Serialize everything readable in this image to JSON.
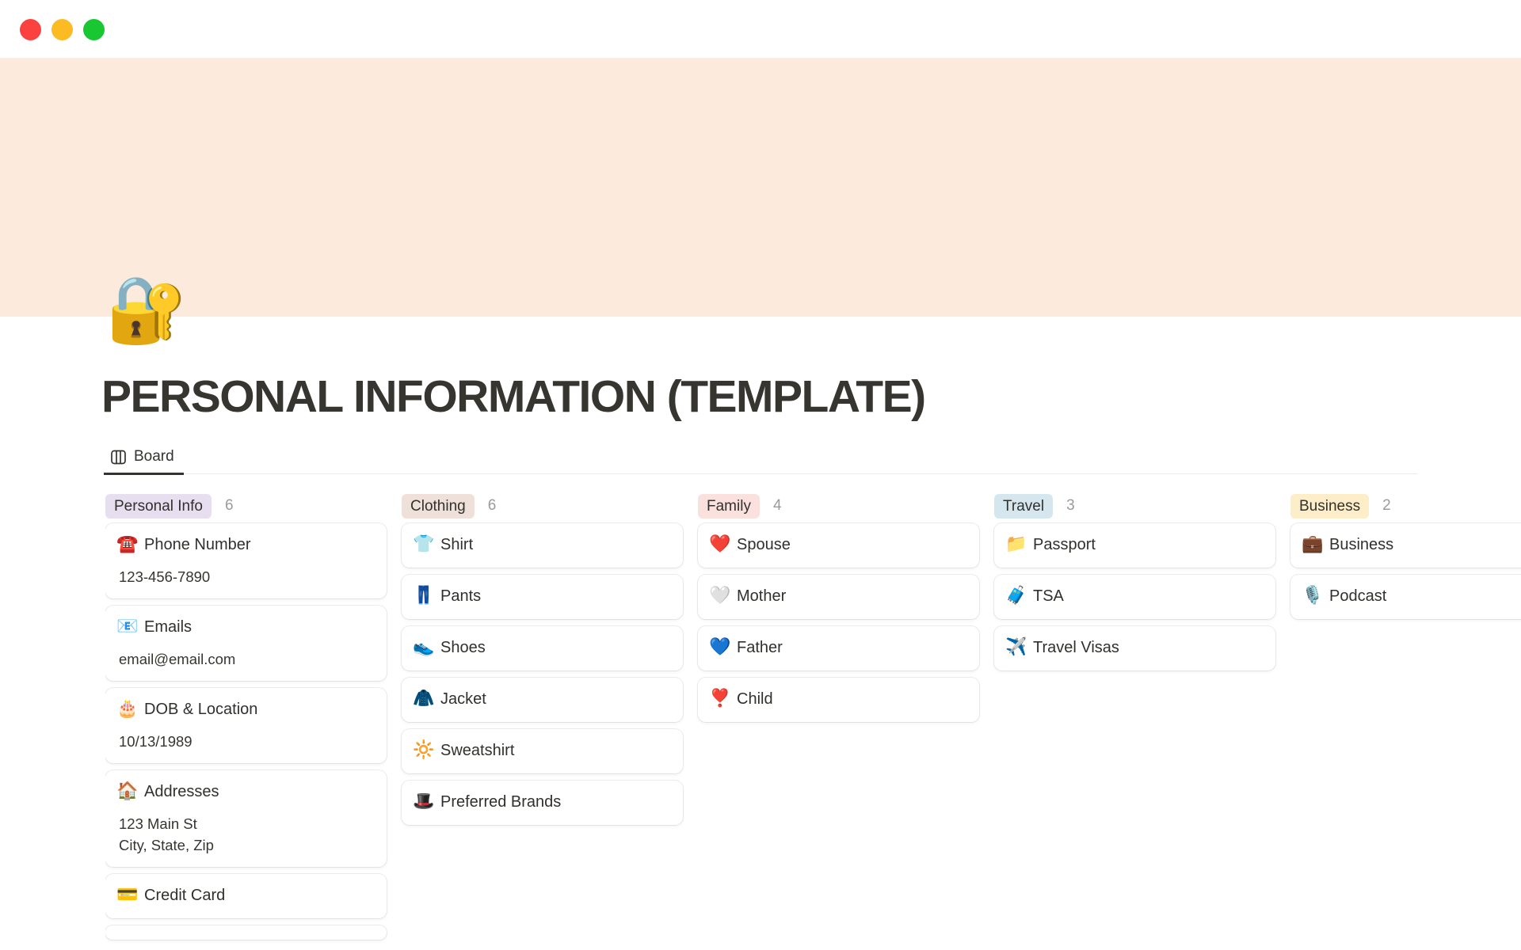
{
  "window": {
    "buttons": [
      {
        "name": "close",
        "color": "#fc4240"
      },
      {
        "name": "minimize",
        "color": "#fcba23"
      },
      {
        "name": "zoom",
        "color": "#19c732"
      }
    ]
  },
  "page": {
    "banner_color": "#fcebdd",
    "icon": "🔐",
    "icon_name": "locked-with-key-icon",
    "title": "PERSONAL INFORMATION (TEMPLATE)",
    "view_tab": {
      "label": "Board"
    }
  },
  "board": {
    "columns": [
      {
        "name": "Personal Info",
        "count": "6",
        "pill_bg": "#e7def0",
        "cards": [
          {
            "icon": "☎️",
            "icon_name": "telephone-icon",
            "icon_color": "#df2c23",
            "title": "Phone Number",
            "lines": [
              "123-456-7890"
            ]
          },
          {
            "icon": "📧",
            "icon_name": "email-icon",
            "icon_color": "#6fa8dc",
            "title": "Emails",
            "lines": [
              "email@email.com"
            ]
          },
          {
            "icon": "🎂",
            "icon_name": "birthday-cake-icon",
            "icon_color": "#e8b9bd",
            "title": "DOB & Location",
            "lines": [
              "10/13/1989"
            ]
          },
          {
            "icon": "🏠",
            "icon_name": "house-icon",
            "icon_color": "#c0504d",
            "title": "Addresses",
            "lines": [
              "123 Main St",
              "City, State, Zip"
            ]
          },
          {
            "icon": "💳",
            "icon_name": "credit-card-icon",
            "icon_color": "#c9b26a",
            "title": "Credit Card",
            "lines": []
          },
          {
            "partial": true
          }
        ]
      },
      {
        "name": "Clothing",
        "count": "6",
        "pill_bg": "#efe0da",
        "cards": [
          {
            "icon": "👕",
            "icon_name": "shirt-icon",
            "icon_color": "#5b9bd5",
            "title": "Shirt",
            "lines": []
          },
          {
            "icon": "👖",
            "icon_name": "jeans-icon",
            "icon_color": "#3b5aa9",
            "title": "Pants",
            "lines": []
          },
          {
            "icon": "👟",
            "icon_name": "sneaker-icon",
            "icon_color": "#9e9e9e",
            "title": "Shoes",
            "lines": []
          },
          {
            "icon": "🧥",
            "icon_name": "coat-icon",
            "icon_color": "#c79a3b",
            "title": "Jacket",
            "lines": []
          },
          {
            "icon": "🔆",
            "icon_name": "sun-bright-icon",
            "icon_color": "#f5a623",
            "title": "Sweatshirt",
            "lines": []
          },
          {
            "icon": "🎩",
            "icon_name": "top-hat-icon",
            "icon_color": "#2b2b2b",
            "title": "Preferred Brands",
            "lines": []
          }
        ]
      },
      {
        "name": "Family",
        "count": "4",
        "pill_bg": "#fbe1dd",
        "cards": [
          {
            "icon": "❤️",
            "icon_name": "red-heart-icon",
            "icon_color": "#e02f2f",
            "title": "Spouse",
            "lines": []
          },
          {
            "icon": "🤍",
            "icon_name": "white-heart-icon",
            "icon_color": "#d9d9d9",
            "title": "Mother",
            "lines": []
          },
          {
            "icon": "💙",
            "icon_name": "blue-heart-icon",
            "icon_color": "#2a6df4",
            "title": "Father",
            "lines": []
          },
          {
            "icon": "❣️",
            "icon_name": "heart-exclamation-icon",
            "icon_color": "#e02f2f",
            "title": "Child",
            "lines": []
          }
        ]
      },
      {
        "name": "Travel",
        "count": "3",
        "pill_bg": "#d6e6ef",
        "cards": [
          {
            "icon": "📁",
            "icon_name": "file-folder-icon",
            "icon_color": "#a8a8a8",
            "title": "Passport",
            "lines": []
          },
          {
            "icon": "🧳",
            "icon_name": "luggage-icon",
            "icon_color": "#8a5a3b",
            "title": "TSA",
            "lines": []
          },
          {
            "icon": "✈️",
            "icon_name": "airplane-icon",
            "icon_color": "#5b9bd5",
            "title": "Travel Visas",
            "lines": []
          }
        ]
      },
      {
        "name": "Business",
        "count": "2",
        "pill_bg": "#fdedc8",
        "cards": [
          {
            "icon": "💼",
            "icon_name": "briefcase-icon",
            "icon_color": "#8a5a3b",
            "title": "Business",
            "lines": []
          },
          {
            "icon": "🎙️",
            "icon_name": "microphone-icon",
            "icon_color": "#8f8f8f",
            "title": "Podcast",
            "lines": []
          }
        ]
      }
    ]
  }
}
